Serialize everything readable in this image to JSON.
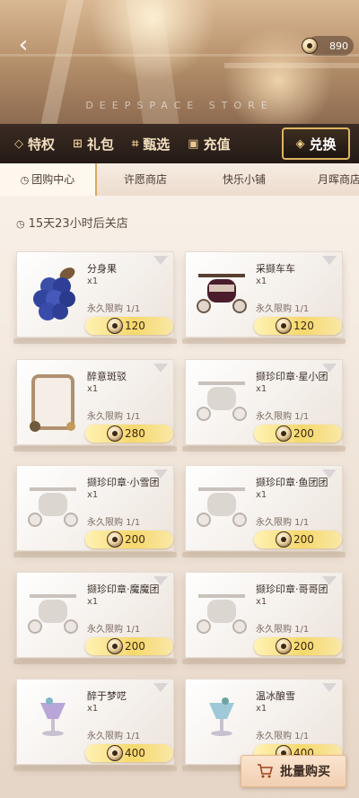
{
  "header": {
    "currency_amount": "890",
    "store_caption": "DEEPSPACE STORE"
  },
  "main_nav": [
    {
      "label": "特权",
      "icon": "diamond-icon"
    },
    {
      "label": "礼包",
      "icon": "gift-icon"
    },
    {
      "label": "甄选",
      "icon": "select-icon"
    },
    {
      "label": "充值",
      "icon": "recharge-icon"
    },
    {
      "label": "兑换",
      "icon": "exchange-icon"
    }
  ],
  "sub_tabs": [
    {
      "label": "团购中心"
    },
    {
      "label": "许愿商店"
    },
    {
      "label": "快乐小铺"
    },
    {
      "label": "月晖商店"
    }
  ],
  "timer": "15天23小时后关店",
  "items": [
    {
      "name": "分身果",
      "qty": "x1",
      "limit": "永久限购 1/1",
      "price": "120",
      "thumb": "blueberry"
    },
    {
      "name": "采撷车车",
      "qty": "x1",
      "limit": "永久限购 1/1",
      "price": "120",
      "thumb": "cart-dark"
    },
    {
      "name": "醉意斑驳",
      "qty": "x1",
      "limit": "永久限购 1/1",
      "price": "280",
      "thumb": "frame"
    },
    {
      "name": "撷珍印章·星小团",
      "qty": "x1",
      "limit": "永久限购 1/1",
      "price": "200",
      "thumb": "cart-light"
    },
    {
      "name": "撷珍印章·小雪团",
      "qty": "x1",
      "limit": "永久限购 1/1",
      "price": "200",
      "thumb": "cart-light"
    },
    {
      "name": "撷珍印章·鱼团团",
      "qty": "x1",
      "limit": "永久限购 1/1",
      "price": "200",
      "thumb": "cart-light"
    },
    {
      "name": "撷珍印章·魔魔团",
      "qty": "x1",
      "limit": "永久限购 1/1",
      "price": "200",
      "thumb": "cart-light"
    },
    {
      "name": "撷珍印章·哥哥团",
      "qty": "x1",
      "limit": "永久限购 1/1",
      "price": "200",
      "thumb": "cart-light"
    },
    {
      "name": "醉于梦呓",
      "qty": "x1",
      "limit": "永久限购 1/1",
      "price": "400",
      "thumb": "goblet"
    },
    {
      "name": "温冰酿雪",
      "qty": "x1",
      "limit": "永久限购 1/1",
      "price": "400",
      "thumb": "goblet"
    }
  ],
  "bulk_buy_label": "批量购买",
  "colors": {
    "accent_gold": "#e0b561",
    "nav_bg": "#2c211b",
    "price_button": "#f6d86c"
  }
}
